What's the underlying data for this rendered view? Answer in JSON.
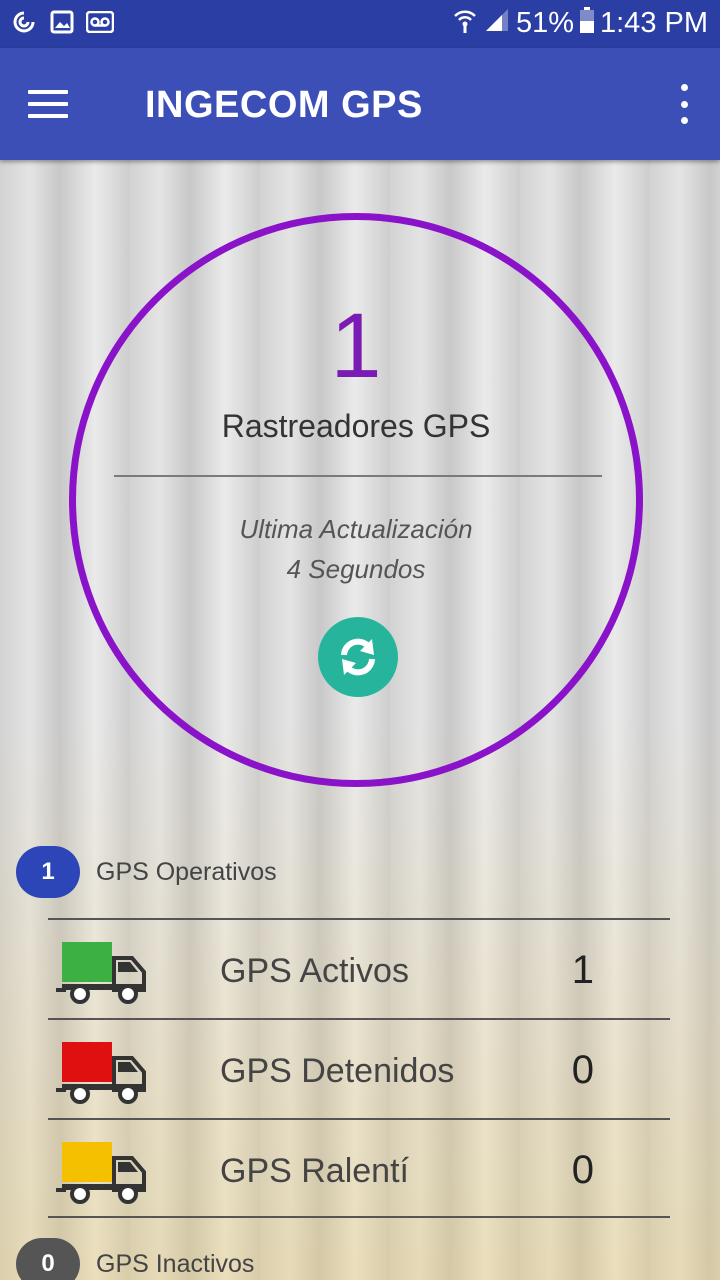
{
  "status_bar": {
    "battery": "51%",
    "time": "1:43 PM"
  },
  "app_bar": {
    "title": "INGECOM GPS"
  },
  "summary": {
    "count": "1",
    "label": "Rastreadores GPS",
    "update_label": "Ultima Actualización",
    "update_value": "4 Segundos"
  },
  "operativos": {
    "badge": "1",
    "label": "GPS Operativos",
    "rows": [
      {
        "label": "GPS Activos",
        "value": "1",
        "color": "#3cb043"
      },
      {
        "label": "GPS Detenidos",
        "value": "0",
        "color": "#e01010"
      },
      {
        "label": "GPS Ralentí",
        "value": "0",
        "color": "#f5c000"
      }
    ]
  },
  "inactivos": {
    "badge": "0",
    "label": "GPS Inactivos"
  },
  "colors": {
    "primary": "#3b4fb6",
    "circle": "#8a12c8",
    "refresh": "#26b59c"
  }
}
